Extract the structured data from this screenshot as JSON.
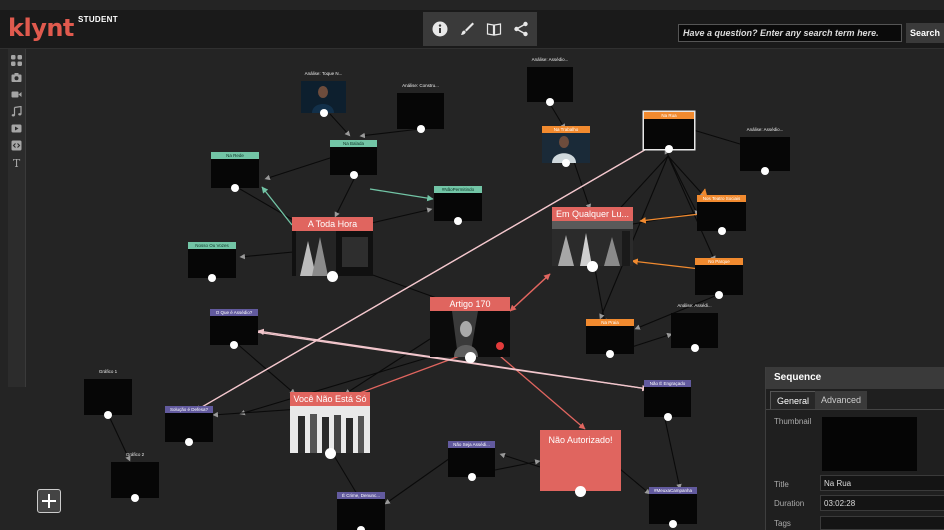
{
  "app": {
    "logo": "klynt",
    "edition": "STUDENT",
    "search_placeholder": "Have a question? Enter any search term here.",
    "search_button": "Search"
  },
  "toolbar": {
    "icons": [
      "info-icon",
      "brush-icon",
      "book-icon",
      "share-icon"
    ]
  },
  "sidebar": {
    "icons": [
      "grid-icon",
      "camera-icon",
      "video-icon",
      "music-icon",
      "play-icon",
      "embed-icon",
      "text-icon"
    ],
    "text_glyph": "T"
  },
  "nodes": {
    "n1": "Análise: Toque N...",
    "n2": "Análise: Constru...",
    "n3": "Análise: Assédio...",
    "n4": "Na Balada",
    "n5": "Na Rede",
    "n6": "Na Trabalho",
    "n7": "Na Rua",
    "n8": "Análise: Assédio...",
    "n9": "#NãoPermitindo",
    "n10": "Nos Teatro Sociais",
    "n11": "A Toda Hora",
    "n12": "Em Qualquer Lu...",
    "n13": "Nosso Ou Vozes",
    "n14": "No Parque",
    "n15": "Artigo 170",
    "n16": "O Que é Assédio?",
    "n17": "Na Praia",
    "n18": "Análise: Assédi...",
    "n19": "Gráfico 1",
    "n20": "Solução é Defesa?",
    "n21": "Você Não Está Só",
    "n22": "Não É Engraçado",
    "n23": "Não Autorizado!",
    "n24": "Não Seja Assédi...",
    "n25": "Gráfico 2",
    "n26": "É Crime, Denunc...",
    "n27": "#MeuxaCampanha"
  },
  "sequence": {
    "header": "Sequence",
    "tab_general": "General",
    "tab_advanced": "Advanced",
    "thumbnail_label": "Thumbnail",
    "title_label": "Title",
    "title_value": "Na Rua",
    "duration_label": "Duration",
    "duration_value": "03:02:28",
    "tags_label": "Tags"
  },
  "colors": {
    "accent_red": "#e0655f",
    "tag_green": "#72c5a6",
    "tag_orange": "#f18a2f",
    "tag_purple": "#625a9e",
    "logo_red": "#e05a4e"
  }
}
